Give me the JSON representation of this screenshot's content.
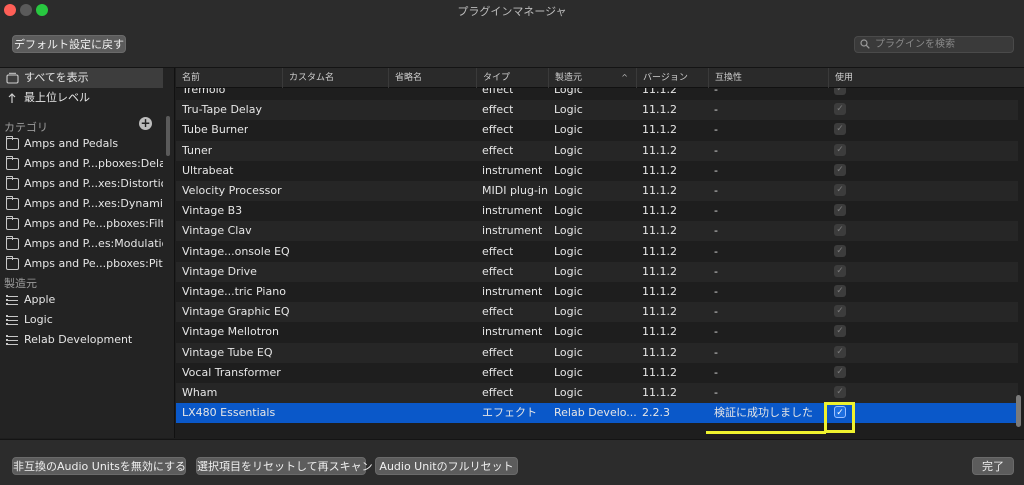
{
  "window": {
    "title": "プラグインマネージャ"
  },
  "toolbar": {
    "reset_defaults_label": "デフォルト設定に戻す",
    "search_placeholder": "プラグインを検索"
  },
  "sidebar": {
    "top_items": [
      {
        "label": "すべてを表示",
        "icon": "display-icon",
        "selected": true
      },
      {
        "label": "最上位レベル",
        "icon": "arrow-up-icon",
        "selected": false
      }
    ],
    "category_header": "カテゴリ",
    "categories": [
      "Amps and Pedals",
      "Amps and P...pboxes:Delay",
      "Amps and P...xes:Distortion",
      "Amps and P...xes:Dynamics",
      "Amps and Pe...pboxes:Filter",
      "Amps and P...es:Modulation",
      "Amps and Pe...pboxes:Pitch"
    ],
    "manufacturer_header": "製造元",
    "manufacturers": [
      "Apple",
      "Logic",
      "Relab Development"
    ]
  },
  "table": {
    "columns": [
      "名前",
      "カスタム名",
      "省略名",
      "タイプ",
      "製造元",
      "バージョン",
      "互換性",
      "使用"
    ],
    "sort_indicator": "^",
    "rows": [
      {
        "name": "Tremolo",
        "type": "effect",
        "manufacturer": "Logic",
        "version": "11.1.2",
        "compat": "-",
        "use": "✓"
      },
      {
        "name": "Tru-Tape Delay",
        "type": "effect",
        "manufacturer": "Logic",
        "version": "11.1.2",
        "compat": "-",
        "use": "✓"
      },
      {
        "name": "Tube Burner",
        "type": "effect",
        "manufacturer": "Logic",
        "version": "11.1.2",
        "compat": "-",
        "use": "✓"
      },
      {
        "name": "Tuner",
        "type": "effect",
        "manufacturer": "Logic",
        "version": "11.1.2",
        "compat": "-",
        "use": "✓"
      },
      {
        "name": "Ultrabeat",
        "type": "instrument",
        "manufacturer": "Logic",
        "version": "11.1.2",
        "compat": "-",
        "use": "✓"
      },
      {
        "name": "Velocity Processor",
        "type": "MIDI plug-in",
        "manufacturer": "Logic",
        "version": "11.1.2",
        "compat": "-",
        "use": "✓"
      },
      {
        "name": "Vintage B3",
        "type": "instrument",
        "manufacturer": "Logic",
        "version": "11.1.2",
        "compat": "-",
        "use": "✓"
      },
      {
        "name": "Vintage Clav",
        "type": "instrument",
        "manufacturer": "Logic",
        "version": "11.1.2",
        "compat": "-",
        "use": "✓"
      },
      {
        "name": "Vintage...onsole EQ",
        "type": "effect",
        "manufacturer": "Logic",
        "version": "11.1.2",
        "compat": "-",
        "use": "✓"
      },
      {
        "name": "Vintage Drive",
        "type": "effect",
        "manufacturer": "Logic",
        "version": "11.1.2",
        "compat": "-",
        "use": "✓"
      },
      {
        "name": "Vintage...tric Piano",
        "type": "instrument",
        "manufacturer": "Logic",
        "version": "11.1.2",
        "compat": "-",
        "use": "✓"
      },
      {
        "name": "Vintage Graphic EQ",
        "type": "effect",
        "manufacturer": "Logic",
        "version": "11.1.2",
        "compat": "-",
        "use": "✓"
      },
      {
        "name": "Vintage Mellotron",
        "type": "instrument",
        "manufacturer": "Logic",
        "version": "11.1.2",
        "compat": "-",
        "use": "✓"
      },
      {
        "name": "Vintage Tube EQ",
        "type": "effect",
        "manufacturer": "Logic",
        "version": "11.1.2",
        "compat": "-",
        "use": "✓"
      },
      {
        "name": "Vocal Transformer",
        "type": "effect",
        "manufacturer": "Logic",
        "version": "11.1.2",
        "compat": "-",
        "use": "✓"
      },
      {
        "name": "Wham",
        "type": "effect",
        "manufacturer": "Logic",
        "version": "11.1.2",
        "compat": "-",
        "use": "✓"
      },
      {
        "name": "LX480 Essentials",
        "type": "エフェクト",
        "manufacturer": "Relab Develo...",
        "version": "2.2.3",
        "compat": "検証に成功しました",
        "use": "✓",
        "selected": true
      }
    ]
  },
  "footer": {
    "disable_incompatible_label": "非互換のAudio Unitsを無効にする",
    "reset_rescan_label": "選択項目をリセットして再スキャン",
    "full_reset_label": "Audio Unitのフルリセット",
    "done_label": "完了"
  },
  "colors": {
    "selection_blue": "#0a58c9",
    "highlight_yellow": "#eef22e",
    "window_bg": "#1e1e1e"
  }
}
